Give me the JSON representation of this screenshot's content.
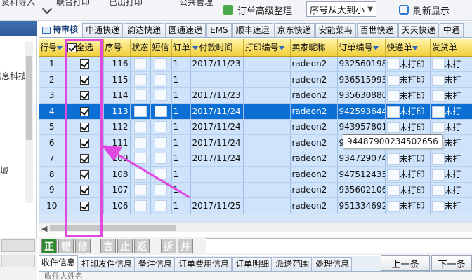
{
  "toolbar": {
    "clipped_menu": [
      "资料导入",
      "联合打印",
      "已出打印",
      "公共管理"
    ],
    "advanced_sort": "订单高级整理",
    "sort_value": "序号从大到小",
    "refresh": "刷新显示"
  },
  "left_panel": {
    "text1": "信息科技",
    "text2": "城"
  },
  "tabs": [
    "待审核",
    "申通快递",
    "韵达快递",
    "圆通速递",
    "EMS",
    "顺丰速运",
    "京东快递",
    "安能菜鸟",
    "百世快递",
    "天天快递",
    "中通"
  ],
  "grid": {
    "headers": [
      "行号",
      "全选",
      "序号",
      "状态",
      "短信",
      "订单",
      "付款时间",
      "打印编号",
      "卖家昵称",
      "订单编号",
      "快递单",
      "发货单"
    ],
    "rows": [
      {
        "row": "1",
        "seq": "116",
        "ord": "1",
        "pay": "2017/11/23",
        "seller": "radeon2",
        "order": "932560198",
        "express": "未打印",
        "ship": "未打"
      },
      {
        "row": "2",
        "seq": "115",
        "ord": "1",
        "pay": "",
        "seller": "radeon2",
        "order": "936515993",
        "express": "未打印",
        "ship": "未打"
      },
      {
        "row": "3",
        "seq": "114",
        "ord": "1",
        "pay": "2017/11/23",
        "seller": "radeon2",
        "order": "935630880",
        "express": "未打印",
        "ship": "未打"
      },
      {
        "row": "4",
        "seq": "113",
        "ord": "1",
        "pay": "2017/11/24",
        "seller": "radeon2",
        "order": "942593644",
        "express": "未打印",
        "ship": "未打"
      },
      {
        "row": "5",
        "seq": "112",
        "ord": "1",
        "pay": "2017/11/24",
        "seller": "radeon2",
        "order": "943957801",
        "express": "未打印",
        "ship": "未打"
      },
      {
        "row": "6",
        "seq": "111",
        "ord": "1",
        "pay": "2017/11/24",
        "seller": "radeon2",
        "order": "946014118",
        "express": "未打印",
        "ship": "未打"
      },
      {
        "row": "7",
        "seq": "109",
        "ord": "1",
        "pay": "2017/11/24",
        "seller": "radeon2",
        "order": "934729074",
        "express": "未打印",
        "ship": "未打"
      },
      {
        "row": "8",
        "seq": "108",
        "ord": "1",
        "pay": "",
        "seller": "radeon2",
        "order": "947512435",
        "express": "未打印",
        "ship": "未打"
      },
      {
        "row": "9",
        "seq": "107",
        "ord": "1",
        "pay": "",
        "seller": "radeon2",
        "order": "935602106",
        "express": "未打印",
        "ship": "未打"
      },
      {
        "row": "10",
        "seq": "106",
        "ord": "1",
        "pay": "2017/11/25",
        "seller": "radeon2",
        "order": "951334692",
        "express": "未打印",
        "ship": "未打"
      }
    ],
    "tooltip": "94487900234502656"
  },
  "action_buttons": [
    "正",
    "错",
    "修",
    "言",
    "止",
    "返",
    "拆",
    "并"
  ],
  "bottom_tabs": [
    "收件信息",
    "打印发件信息",
    "备注信息",
    "订单费用信息",
    "订单明细",
    "派送范围",
    "处理信息"
  ],
  "nav": {
    "prev": "上一条",
    "next": "下一条"
  },
  "bottom_clipped": "收件人姓名"
}
